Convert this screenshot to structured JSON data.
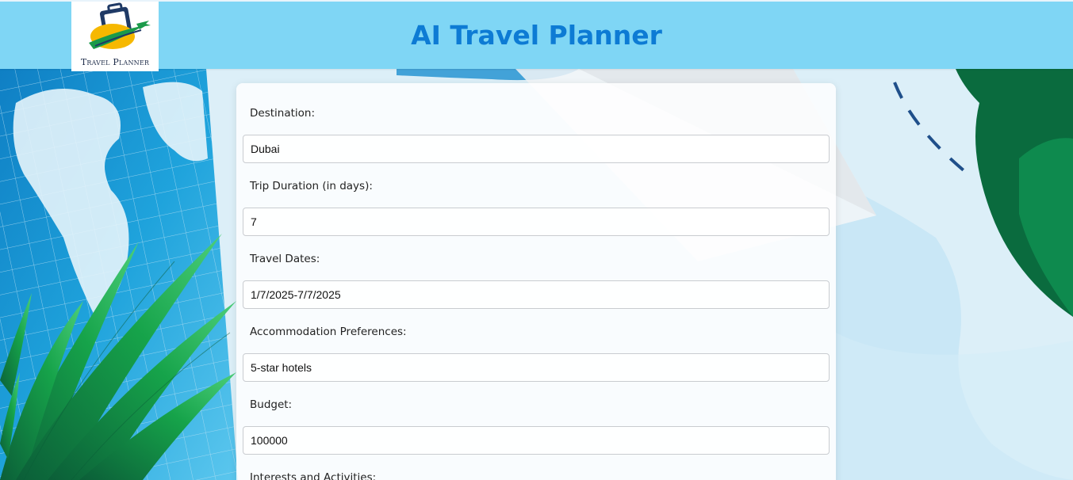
{
  "header": {
    "logo_text": "Travel Planner",
    "title": "AI Travel Planner"
  },
  "form": {
    "fields": [
      {
        "label": "Destination:",
        "value": "Dubai"
      },
      {
        "label": "Trip Duration (in days):",
        "value": "7"
      },
      {
        "label": "Travel Dates:",
        "value": "1/7/2025-7/7/2025"
      },
      {
        "label": "Accommodation Preferences:",
        "value": "5-star hotels"
      },
      {
        "label": "Budget:",
        "value": "100000"
      },
      {
        "label": "Interests and Activities:",
        "value": ""
      }
    ]
  },
  "colors": {
    "header_bg": "#7fd6f5",
    "title": "#0d7bd4",
    "leaf_green": "#1aa14f",
    "map_blue": "#1b8fd0"
  }
}
